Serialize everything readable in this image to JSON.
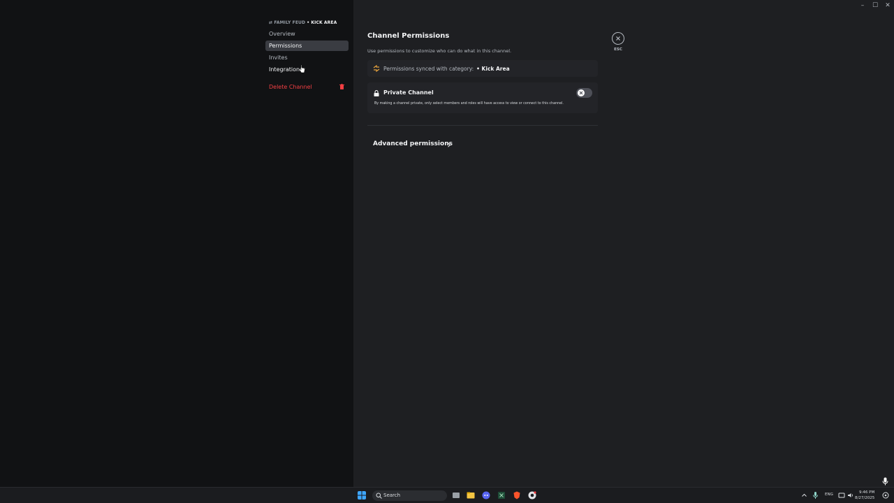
{
  "window": {
    "minimize": "–",
    "maximize": "☐",
    "close": "✕"
  },
  "sidebar": {
    "header_server": "FAMILY FEUD",
    "header_category": "• KICK AREA",
    "items": [
      {
        "label": "Overview"
      },
      {
        "label": "Permissions"
      },
      {
        "label": "Invites"
      },
      {
        "label": "Integrations"
      }
    ],
    "delete_label": "Delete Channel"
  },
  "main": {
    "title": "Channel Permissions",
    "subtitle": "Use permissions to customize who can do what in this channel.",
    "sync_text": "Permissions synced with category:",
    "sync_category": "• Kick Area",
    "private_title": "Private Channel",
    "private_desc": "By making a channel private, only select members and roles will have access to view or connect to this channel.",
    "private_enabled": false,
    "advanced_label": "Advanced permissions",
    "esc_label": "ESC"
  },
  "taskbar": {
    "search_placeholder": "Search",
    "lang": "ENG",
    "time": "9:46 PM",
    "date": "8/27/2025"
  },
  "colors": {
    "danger": "#f23f43",
    "accent_sync": "#e8a33d"
  }
}
